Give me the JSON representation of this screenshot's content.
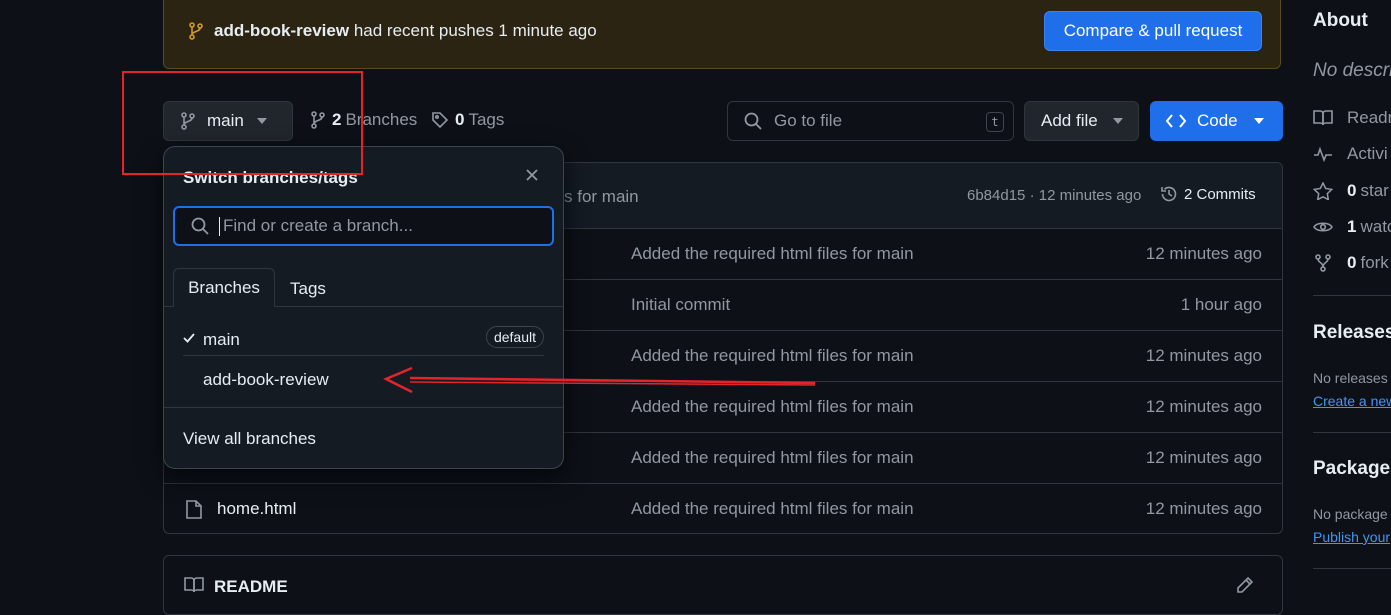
{
  "banner": {
    "branch": "add-book-review",
    "text": "had recent pushes 1 minute ago",
    "compare_button": "Compare & pull request"
  },
  "toolbar": {
    "branch_button": "main",
    "branches_count": "2",
    "branches_label": "Branches",
    "tags_count": "0",
    "tags_label": "Tags",
    "goto_placeholder": "Go to file",
    "goto_shortcut": "t",
    "add_file": "Add file",
    "code": "Code"
  },
  "latest_commit": {
    "message_fragment": "s for main",
    "sha_time": "6b84d15 · 12 minutes ago",
    "commits": "2 Commits"
  },
  "files": [
    {
      "name": "",
      "message": "Added the required html files for main",
      "time": "12 minutes ago"
    },
    {
      "name": "",
      "message": "Initial commit",
      "time": "1 hour ago"
    },
    {
      "name": "",
      "message": "Added the required html files for main",
      "time": "12 minutes ago"
    },
    {
      "name": "",
      "message": "Added the required html files for main",
      "time": "12 minutes ago"
    },
    {
      "name": "",
      "message": "Added the required html files for main",
      "time": "12 minutes ago"
    },
    {
      "name": "home.html",
      "message": "Added the required html files for main",
      "time": "12 minutes ago"
    }
  ],
  "readme": {
    "label": "README"
  },
  "dropdown": {
    "title": "Switch branches/tags",
    "search_placeholder": "Find or create a branch...",
    "tabs": [
      "Branches",
      "Tags"
    ],
    "branches": [
      {
        "name": "main",
        "selected": true,
        "badge": "default"
      },
      {
        "name": "add-book-review",
        "selected": false,
        "badge": ""
      }
    ],
    "view_all": "View all branches"
  },
  "sidebar": {
    "about": "About",
    "no_description": "No descri",
    "readme": "Readn",
    "activity": "Activi",
    "stars_count": "0",
    "stars": "star",
    "watch_count": "1",
    "watch": "watc",
    "forks_count": "0",
    "forks": "fork",
    "releases": "Releases",
    "no_releases": "No releases",
    "create_release": "Create a new",
    "packages": "Packages",
    "no_packages": "No package",
    "publish": "Publish your"
  },
  "colors": {
    "background": "#0d1117",
    "accent_blue": "#1f6feb",
    "banner_bg": "#2c2412",
    "annotation_red": "#e5232b"
  }
}
